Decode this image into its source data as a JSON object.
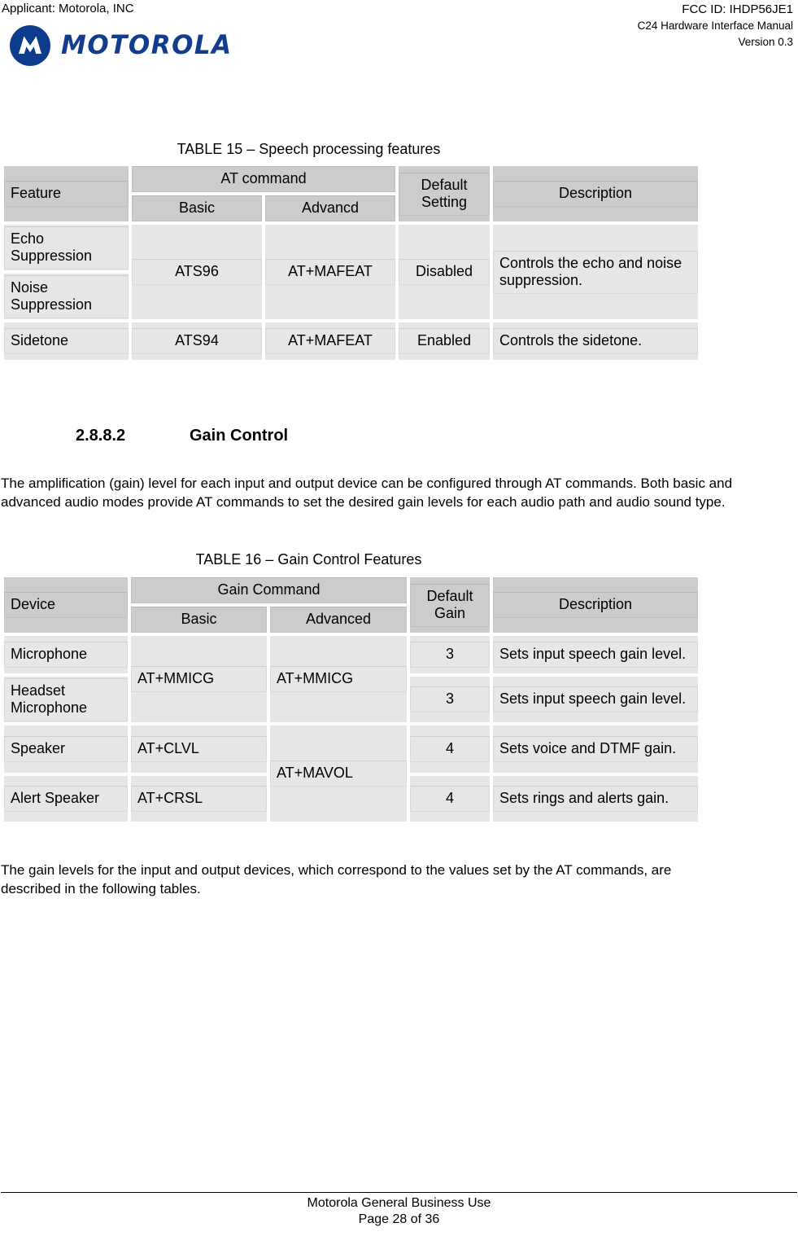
{
  "header": {
    "applicant": "Applicant: Motorola, INC",
    "fcc_id": "FCC ID: IHDP56JE1",
    "manual": "C24 Hardware Interface Manual",
    "version": "Version 0.3",
    "logo_wordmark": "MOTOROLA",
    "logo_color": "#0d3c8c"
  },
  "table15": {
    "caption": "TABLE 15 – Speech processing features",
    "header_row1": {
      "feature": "Feature",
      "at_command": "AT command",
      "default_setting": "Default Setting",
      "description": "Description"
    },
    "header_row2": {
      "basic": "Basic",
      "advanced": "Advancd"
    },
    "rows": [
      {
        "feature": "Echo Suppression",
        "basic": "ATS96",
        "advanced": "AT+MAFEAT",
        "default": "Disabled",
        "description": "Controls the echo and noise suppression."
      },
      {
        "feature": "Noise Suppression"
      },
      {
        "feature": "Sidetone",
        "basic": "ATS94",
        "advanced": "AT+MAFEAT",
        "default": "Enabled",
        "description": "Controls the sidetone."
      }
    ]
  },
  "section": {
    "number": "2.8.8.2",
    "title": "Gain Control",
    "paragraph": "The amplification (gain) level for each input and output device can be configured through AT commands. Both basic and advanced audio modes provide AT commands to set the desired gain levels for each audio path and audio sound type."
  },
  "table16": {
    "caption": "TABLE 16 – Gain Control Features",
    "header_row1": {
      "device": "Device",
      "gain_command": "Gain Command",
      "default_gain": "Default Gain",
      "description": "Description"
    },
    "header_row2": {
      "basic": "Basic",
      "advanced": "Advanced"
    },
    "rows": [
      {
        "device": "Microphone",
        "basic": "AT+MMICG",
        "advanced": "AT+MMICG",
        "default": "3",
        "description": "Sets input speech gain level."
      },
      {
        "device": "Headset Microphone",
        "default": "3",
        "description": "Sets input speech gain level."
      },
      {
        "device": "Speaker",
        "basic": "AT+CLVL",
        "advanced": "AT+MAVOL",
        "default": "4",
        "description": "Sets voice and DTMF gain."
      },
      {
        "device": "Alert Speaker",
        "basic": "AT+CRSL",
        "default": "4",
        "description": "Sets rings and alerts gain."
      }
    ]
  },
  "closing_paragraph": "The gain levels for the input and output devices, which correspond to the values set by the AT commands, are described in the following tables.",
  "footer": {
    "line1": "Motorola General Business Use",
    "line2": "Page 28 of 36"
  }
}
